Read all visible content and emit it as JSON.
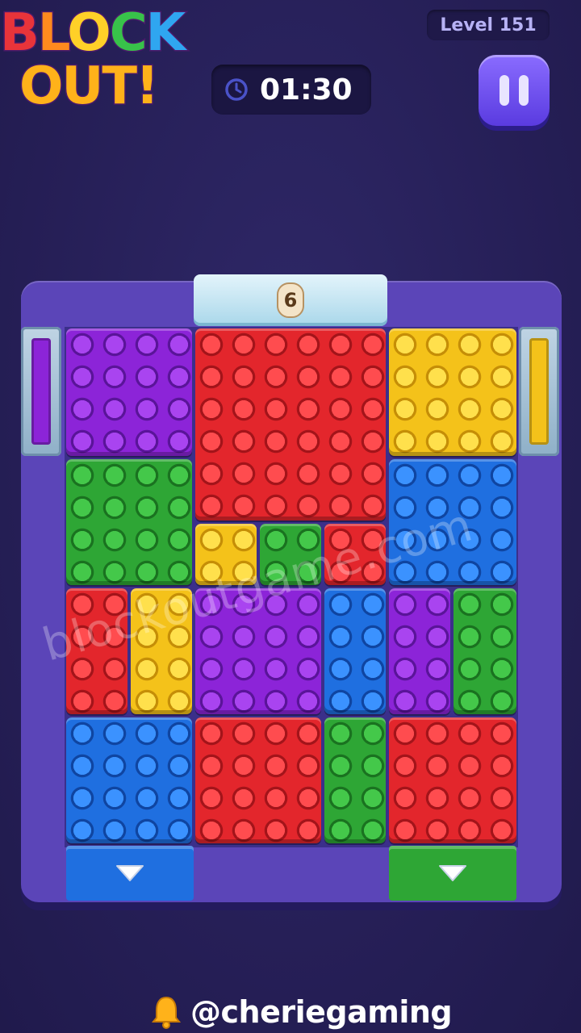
{
  "logo": {
    "line1": [
      "B",
      "L",
      "O",
      "C",
      "K"
    ],
    "line2": "OUT!"
  },
  "header": {
    "level_label": "Level 151",
    "timer": "01:30",
    "clock_icon": "clock-icon",
    "pause_icon": "pause-icon"
  },
  "board": {
    "top_gate_counter": "6",
    "left_gate_color": "#8c24d8",
    "right_gate_color": "#f4c21a",
    "exits": [
      {
        "color": "#1f6fe0",
        "icon": "chevron-down-icon"
      },
      {
        "color": "#2ea635",
        "icon": "chevron-down-icon"
      }
    ],
    "bricks": [
      {
        "color": "purple"
      },
      {
        "color": "red"
      },
      {
        "color": "yellow"
      },
      {
        "color": "green"
      },
      {
        "color": "blue"
      },
      {
        "color": "yellow"
      },
      {
        "color": "green"
      },
      {
        "color": "red"
      },
      {
        "color": "red"
      },
      {
        "color": "yellow"
      },
      {
        "color": "purple"
      },
      {
        "color": "blue"
      },
      {
        "color": "purple"
      },
      {
        "color": "green"
      },
      {
        "color": "blue"
      },
      {
        "color": "red"
      },
      {
        "color": "green"
      },
      {
        "color": "red"
      }
    ]
  },
  "watermark": "blockoutgame.com",
  "footer": {
    "handle": "@cheriegaming",
    "bell_icon": "bell-icon"
  },
  "colors": {
    "background": "#261f57",
    "frame": "#5b45b8",
    "pause_button": "#6b4ef0",
    "red": "#e3262c",
    "yellow": "#f4c21a",
    "green": "#2ea635",
    "blue": "#1f6fe0",
    "purple": "#8c24d8"
  }
}
